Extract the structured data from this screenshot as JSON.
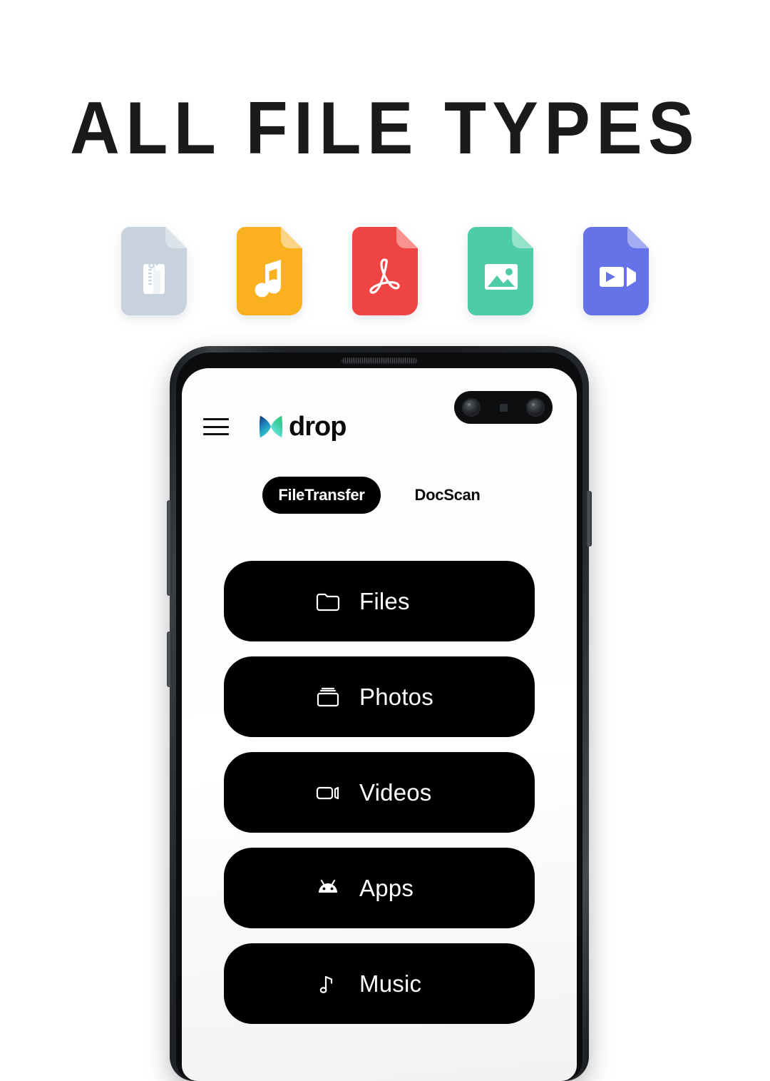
{
  "headline": "ALL FILE TYPES",
  "colors": {
    "accent_black": "#000000",
    "zip": "#C8D2DC",
    "zip_fold": "#DCE3EA",
    "music": "#FBB01F",
    "music_fold": "#FCD488",
    "pdf": "#EF4444",
    "pdf_fold": "#F79490",
    "image": "#4ECCA8",
    "image_fold": "#96E2CB",
    "video": "#6572E8",
    "video_fold": "#A3ABF2"
  },
  "filetypes": [
    {
      "name": "zip-file-icon",
      "label": "ZIP",
      "color": "#C8D2DC",
      "fold": "#DCE3EA"
    },
    {
      "name": "music-file-icon",
      "label": "Music",
      "color": "#FBB01F",
      "fold": "#FCD488"
    },
    {
      "name": "pdf-file-icon",
      "label": "PDF",
      "color": "#EF4444",
      "fold": "#F79490"
    },
    {
      "name": "image-file-icon",
      "label": "Image",
      "color": "#4ECCA8",
      "fold": "#96E2CB"
    },
    {
      "name": "video-file-icon",
      "label": "Video",
      "color": "#6572E8",
      "fold": "#A3ABF2"
    }
  ],
  "app": {
    "menu_icon": "hamburger-menu-icon",
    "logo_icon": "drop-logo-icon",
    "brand": "drop",
    "tabs": [
      {
        "label": "FileTransfer",
        "active": true
      },
      {
        "label": "DocScan",
        "active": false
      }
    ],
    "menu_items": [
      {
        "label": "Files",
        "icon": "folder-icon"
      },
      {
        "label": "Photos",
        "icon": "camera-icon"
      },
      {
        "label": "Videos",
        "icon": "video-camera-icon"
      },
      {
        "label": "Apps",
        "icon": "android-icon"
      },
      {
        "label": "Music",
        "icon": "music-note-icon"
      }
    ]
  },
  "device": {
    "earpiece": "earpiece-speaker",
    "camera": "dual-front-camera",
    "buttons": [
      "volume-rocker",
      "side-key",
      "power-button"
    ]
  }
}
